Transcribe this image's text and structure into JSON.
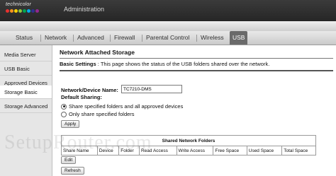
{
  "header": {
    "brand": "technicolor",
    "app_title": "Administration",
    "brand_dot_colors": [
      "#e8312f",
      "#f7941d",
      "#ffd200",
      "#8dc63f",
      "#00a651",
      "#00aeef",
      "#2e3192",
      "#92278f"
    ]
  },
  "nav": {
    "items": [
      "Status",
      "Network",
      "Advanced",
      "Firewall",
      "Parental Control",
      "Wireless",
      "USB"
    ],
    "active": "USB"
  },
  "sidebar": {
    "items": [
      "Media Server",
      "USB Basic",
      "Approved Devices",
      "Storage Basic",
      "Storage Advanced"
    ],
    "active": "Storage Basic"
  },
  "main": {
    "title": "Network Attached Storage",
    "description_bold": "Basic Settings",
    "description_text": ": This page shows the status of the USB folders shared over the network.",
    "device_name_label": "Network/Device Name:",
    "device_name_value": "TC7210-DMS",
    "default_sharing_label": "Default Sharing:",
    "sharing_options": [
      {
        "label": "Share specified folders and all approved devices",
        "selected": true
      },
      {
        "label": "Only share specified folders",
        "selected": false
      }
    ],
    "apply_label": "Apply",
    "table": {
      "caption": "Shared Network Folders",
      "columns": [
        "Share Name",
        "Device",
        "Folder",
        "Read Access",
        "Write Access",
        "Free Space",
        "Used Space",
        "Total Space"
      ]
    },
    "edit_label": "Edit",
    "refresh_label": "Refresh"
  },
  "watermark": "SetupRouter.com"
}
